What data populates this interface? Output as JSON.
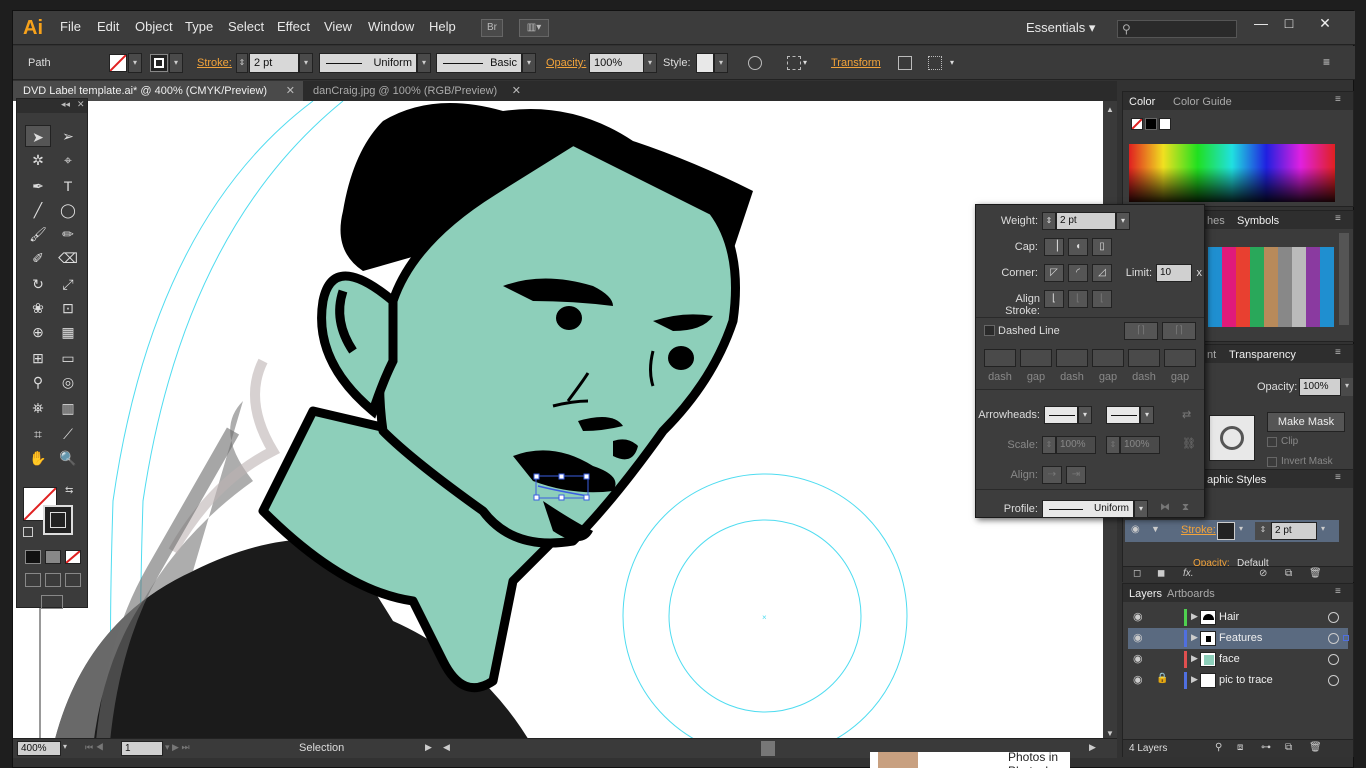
{
  "app": {
    "logo": "Ai",
    "workspace": "Essentials",
    "search_icon": "⚲"
  },
  "menu": [
    "File",
    "Edit",
    "Object",
    "Type",
    "Select",
    "Effect",
    "View",
    "Window",
    "Help"
  ],
  "menu_buttons": {
    "bridge": "Br",
    "arrange": "▥▾"
  },
  "window_controls": {
    "minimize": "—",
    "maximize": "□",
    "close": "✕"
  },
  "control_bar": {
    "selection_type": "Path",
    "stroke_label": "Stroke:",
    "stroke_weight": "2 pt",
    "profile_label": "Uniform",
    "brush_label": "Basic",
    "opacity_label": "Opacity:",
    "opacity_value": "100%",
    "style_label": "Style:",
    "transform_label": "Transform"
  },
  "tabs": [
    {
      "label": "DVD Label template.ai* @ 400% (CMYK/Preview)",
      "close": "✕",
      "active": true
    },
    {
      "label": "danCraig.jpg @ 100% (RGB/Preview)",
      "close": "✕",
      "active": false
    }
  ],
  "status_bar": {
    "zoom": "400%",
    "artboard": "1",
    "tool": "Selection"
  },
  "color_panel": {
    "tabs": [
      "Color",
      "Color Guide"
    ]
  },
  "swatch_panel": {
    "tabs": [
      "hes",
      "Symbols"
    ]
  },
  "transparency_panel": {
    "tabs": [
      "nt",
      "Transparency"
    ],
    "opacity_label": "Opacity:",
    "opacity_value": "100%",
    "make_mask": "Make Mask",
    "clip": "Clip",
    "invert_mask": "Invert Mask"
  },
  "appearance_panel": {
    "tab": "aphic Styles",
    "stroke_label": "Stroke:",
    "stroke_weight": "2 pt",
    "opacity_label": "Opacity:",
    "opacity_value": "Default",
    "fx": "fx."
  },
  "stroke_panel": {
    "weight_label": "Weight:",
    "weight_value": "2 pt",
    "cap_label": "Cap:",
    "corner_label": "Corner:",
    "limit_label": "Limit:",
    "limit_value": "10",
    "limit_unit": "x",
    "align_label": "Align Stroke:",
    "dashed_label": "Dashed Line",
    "dash_labels": [
      "dash",
      "gap",
      "dash",
      "gap",
      "dash",
      "gap"
    ],
    "arrowheads_label": "Arrowheads:",
    "scale_label": "Scale:",
    "scale_start": "100%",
    "scale_end": "100%",
    "align_arrow_label": "Align:",
    "profile_label": "Profile:",
    "profile_value": "Uniform"
  },
  "layers_panel": {
    "tabs": [
      "Layers",
      "Artboards"
    ],
    "layers": [
      {
        "name": "Hair",
        "color": "#4fd04f",
        "locked": false,
        "selected": false
      },
      {
        "name": "Features",
        "color": "#4f6fe0",
        "locked": false,
        "selected": true
      },
      {
        "name": "face",
        "color": "#e04f4f",
        "locked": false,
        "selected": false
      },
      {
        "name": "pic to trace",
        "color": "#4f6fe0",
        "locked": true,
        "selected": false
      }
    ],
    "count": "4 Layers"
  },
  "taskbar_peek": "Photos in Photoshop",
  "colors": {
    "face_fill": "#8dcfba",
    "guide_cyan": "#4fdcf0",
    "accent_orange": "#f2a33a"
  }
}
